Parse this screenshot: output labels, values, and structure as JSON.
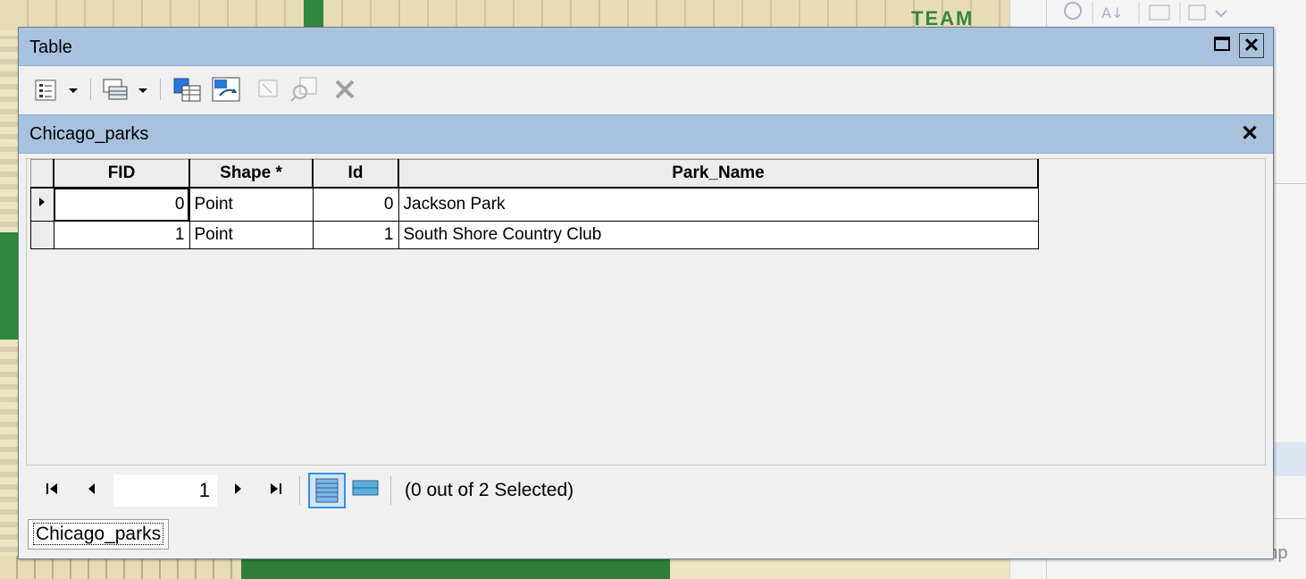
{
  "background": {
    "map_text": "TEAM",
    "right_panel_text": "There are no temp"
  },
  "window": {
    "title": "Table",
    "maximize_label": "",
    "close_label": "✕"
  },
  "toolbar": {
    "buttons": [
      {
        "name": "table-options-icon"
      },
      {
        "name": "related-tables-icon"
      },
      {
        "name": "select-by-attributes-icon"
      },
      {
        "name": "switch-selection-icon"
      },
      {
        "name": "clear-selection-icon"
      },
      {
        "name": "zoom-to-selected-icon"
      },
      {
        "name": "delete-selected-icon"
      }
    ]
  },
  "subtable": {
    "title": "Chicago_parks",
    "close_label": "✕"
  },
  "grid": {
    "columns": [
      "FID",
      "Shape *",
      "Id",
      "Park_Name"
    ],
    "rows": [
      {
        "fid": "0",
        "shape": "Point",
        "id": "0",
        "park_name": "Jackson Park"
      },
      {
        "fid": "1",
        "shape": "Point",
        "id": "1",
        "park_name": "South Shore Country Club"
      }
    ]
  },
  "footer": {
    "page_value": "1",
    "status": "(0 out of 2 Selected)"
  },
  "tabs": [
    {
      "label": "Chicago_parks"
    }
  ],
  "colors": {
    "title_bar": "#a8c2de",
    "accent": "#3a8ee6"
  }
}
